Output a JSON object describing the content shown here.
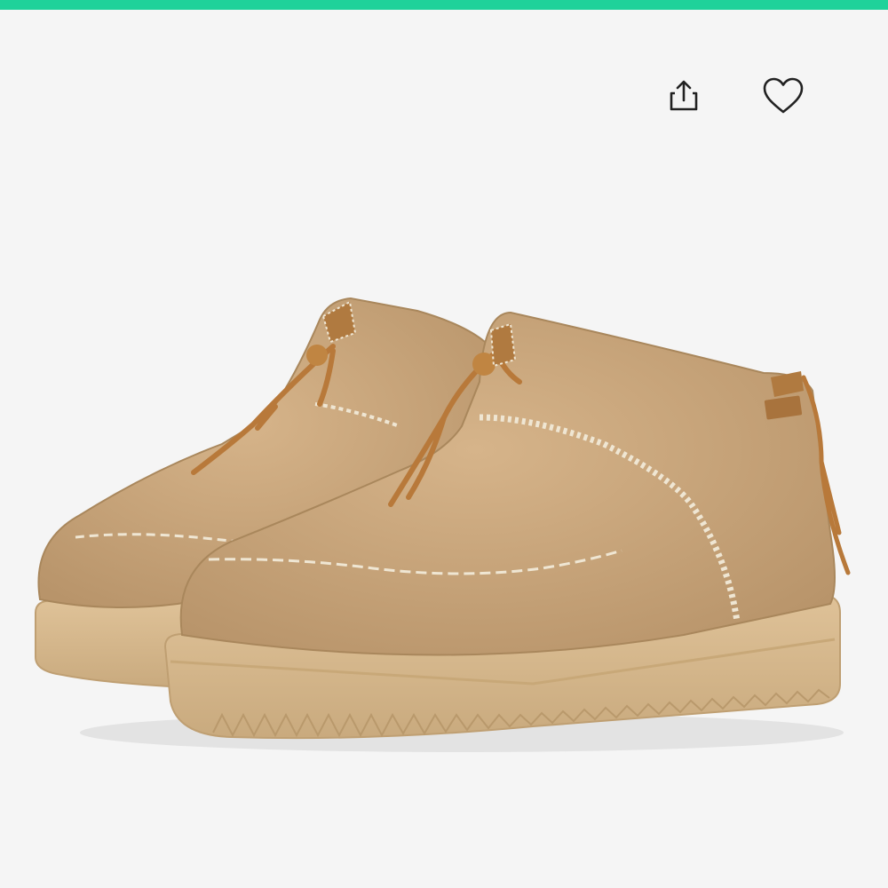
{
  "colors": {
    "accent": "#1fd29a",
    "background": "#f5f5f5",
    "icon": "#222222",
    "suede": "#c8a57a",
    "suede_dark": "#a9875c",
    "sole": "#d8b98c",
    "lace": "#b8793a",
    "stitch": "#efe6d3"
  },
  "actions": {
    "share_icon": "share-icon",
    "favorite_icon": "heart-outline-icon"
  },
  "product": {
    "image_subject": "boot-pair"
  }
}
